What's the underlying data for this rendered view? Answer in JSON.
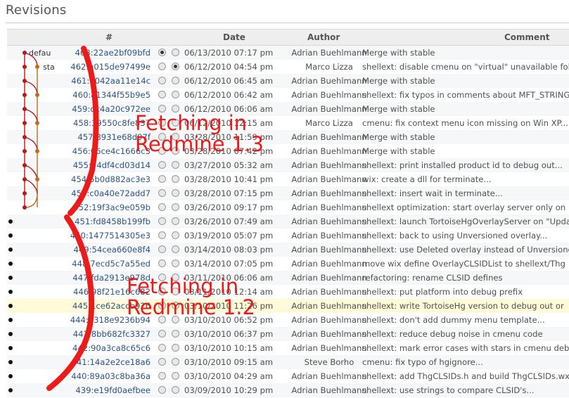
{
  "page": {
    "title": "Revisions"
  },
  "columns": {
    "num": "#",
    "date": "Date",
    "author": "Author",
    "comment": "Comment"
  },
  "branches": {
    "default": "defau",
    "stable": "sta"
  },
  "annotations": {
    "top": [
      "Fetching in",
      "Redmine 1.3"
    ],
    "bottom": [
      "Fetching in",
      "Redmine 1.2"
    ]
  },
  "colors": {
    "link": "#2a5685",
    "annotation": "#ee1a1a",
    "graph_main": "#b31b1b",
    "graph_branch": "#c46a1a"
  },
  "rows": [
    {
      "rev": "463:22ae2bf09bfd",
      "date": "06/13/2010 07:17 pm",
      "author": "Adrian Buehlmann",
      "comment": "Merge with stable",
      "selected": "first"
    },
    {
      "rev": "462:a015de97499e",
      "date": "06/12/2010 04:54 pm",
      "author": "Marco Lizza",
      "comment": "shellext: disable cmenu on \"virtual\" unavailable fold",
      "selected": "second"
    },
    {
      "rev": "461:7042aa11e14c",
      "date": "06/12/2010 06:45 am",
      "author": "Adrian Buehlmann",
      "comment": "Merge with stable"
    },
    {
      "rev": "460:a1344f55b9e5",
      "date": "06/12/2010 06:42 am",
      "author": "Adrian Buehlmann",
      "comment": "shellext: fix typos in comments about MFT_STRING"
    },
    {
      "rev": "459:dc4a20c972ee",
      "date": "06/12/2010 06:06 am",
      "author": "Adrian Buehlmann",
      "comment": "Merge with stable"
    },
    {
      "rev": "458:39550c8fe837",
      "date": "06/12/2010 12:15 am",
      "author": "Marco Lizza",
      "comment": "cmenu: fix context menu icon missing on Win XP..."
    },
    {
      "rev": "457:8931e68d97f",
      "date": "03/28/2010 11:59 pm",
      "author": "Adrian Buehlmann",
      "comment": "Merge with stable"
    },
    {
      "rev": "456:06ce4c1666c3",
      "date": "03/28/2010 07:42 pm",
      "author": "Adrian Buehlmann",
      "comment": "Merge with stable"
    },
    {
      "rev": "455:74df4cd03d14",
      "date": "03/27/2010 05:32 am",
      "author": "Adrian Buehlmann",
      "comment": "shellext: print installed product id to debug out..."
    },
    {
      "rev": "454:5b0d882ac3e3",
      "date": "03/28/2010 10:41 pm",
      "author": "Adrian Buehlmann",
      "comment": "wix: create a dll for terminate..."
    },
    {
      "rev": "453:c0a40e72add7",
      "date": "03/28/2010 07:15 pm",
      "author": "Adrian Buehlmann",
      "comment": "shellext: insert wait in terminate..."
    },
    {
      "rev": "452:19f3ac9e059b",
      "date": "03/26/2010 09:17 pm",
      "author": "Adrian Buehlmann",
      "comment": "shellext optimization: start overlay server only on"
    },
    {
      "rev": "451:fd8458b199fb",
      "date": "03/26/2010 07:49 am",
      "author": "Adrian Buehlmann",
      "comment": "shellext: launch TortoiseHgOverlayServer on \"Upda"
    },
    {
      "rev": "450:1477514305e3",
      "date": "03/19/2010 05:07 pm",
      "author": "Adrian Buehlmann",
      "comment": "shellext: back to using Unversioned overlay..."
    },
    {
      "rev": "449:54cea660e8f4",
      "date": "03/14/2010 08:03 pm",
      "author": "Adrian Buehlmann",
      "comment": "shellext: use Deleted overlay instead of Unversione"
    },
    {
      "rev": "448:7ecd5c7a55ed",
      "date": "03/14/2010 07:05 pm",
      "author": "Adrian Buehlmann",
      "comment": "move wix define OverlayCLSIDList to shellext/Thg"
    },
    {
      "rev": "447:fda2913e978d",
      "date": "03/11/2010 06:06 am",
      "author": "Adrian Buehlmann",
      "comment": "refactoring: rename CLSID defines"
    },
    {
      "rev": "446:98f21e16c682",
      "date": "03/11/2010 12:14 am",
      "author": "Adrian Buehlmann",
      "comment": "shellext: put platform into debug prefix"
    },
    {
      "rev": "445:1ce62accb926",
      "date": "03/10/2010 11:26 pm",
      "author": "Adrian Buehlmann",
      "comment": "shellext: write TortoiseHg version to debug out or",
      "highlight": true
    },
    {
      "rev": "444:0318e9236b94",
      "date": "03/10/2010 06:52 pm",
      "author": "Adrian Buehlmann",
      "comment": "shellext: don't add dummy menu template..."
    },
    {
      "rev": "443:8bb682fc3327",
      "date": "03/10/2010 06:37 pm",
      "author": "Adrian Buehlmann",
      "comment": "shellext: reduce debug noise in cmenu code"
    },
    {
      "rev": "442:90a3ca8c65c6",
      "date": "03/10/2010 10:15 am",
      "author": "Adrian Buehlmann",
      "comment": "shellext: mark error cases with stars in cmenu debu"
    },
    {
      "rev": "441:14a2e2ce18a6",
      "date": "03/10/2010 09:15 am",
      "author": "Steve Borho",
      "comment": "cmenu: fix typo of hgignore..."
    },
    {
      "rev": "440:89a03c8ba36a",
      "date": "03/10/2010 04:29 am",
      "author": "Adrian Buehlmann",
      "comment": "shellext: add ThgCLSIDs.h and build ThgCLSIDs.wxi"
    },
    {
      "rev": "439:e19fd0aefbee",
      "date": "03/09/2010 10:29 pm",
      "author": "Adrian Buehlmann",
      "comment": "shellext: use strings to compare CLSID's..."
    }
  ]
}
